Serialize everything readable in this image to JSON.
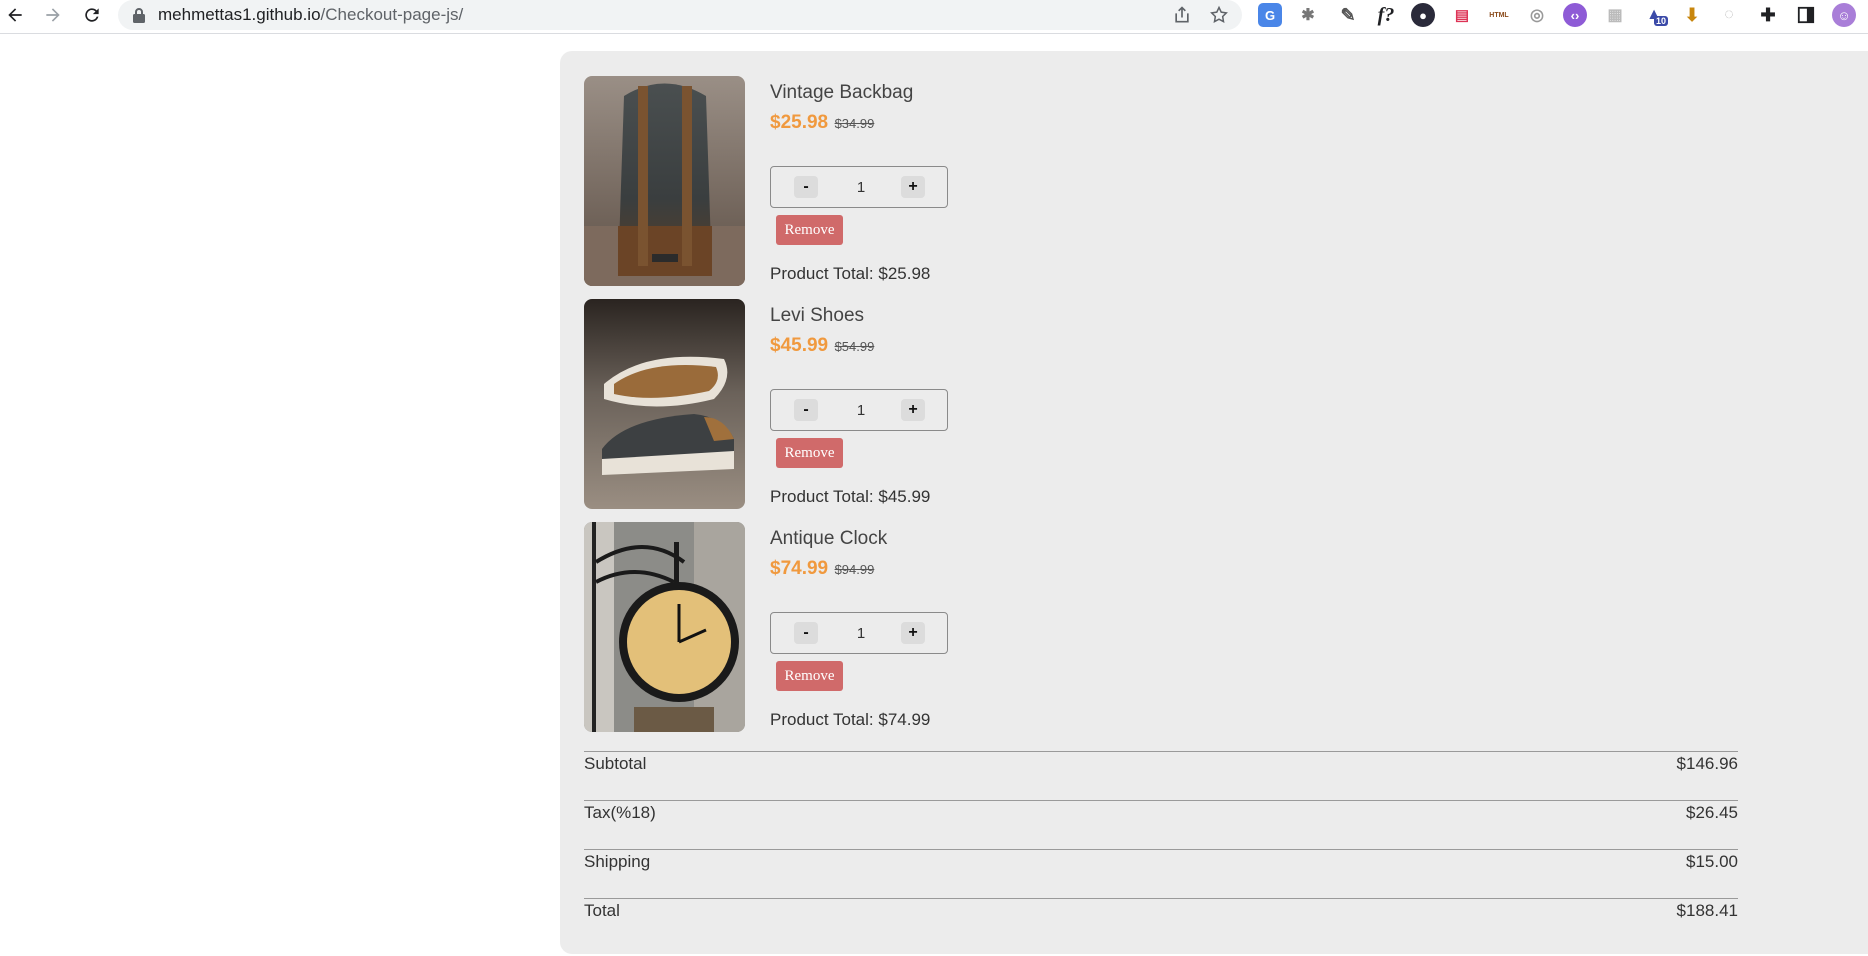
{
  "browser": {
    "url_host": "mehmettas1.github.io",
    "url_path": "/Checkout-page-js/",
    "ext_badge": "10",
    "ext_html_label": "HTML"
  },
  "products": [
    {
      "name": "Vintage Backbag",
      "price": "$25.98",
      "old_price": "$34.99",
      "quantity": "1",
      "minus_label": "-",
      "plus_label": "+",
      "remove_label": "Remove",
      "total": "Product Total: $25.98"
    },
    {
      "name": "Levi Shoes",
      "price": "$45.99",
      "old_price": "$54.99",
      "quantity": "1",
      "minus_label": "-",
      "plus_label": "+",
      "remove_label": "Remove",
      "total": "Product Total: $45.99"
    },
    {
      "name": "Antique Clock",
      "price": "$74.99",
      "old_price": "$94.99",
      "quantity": "1",
      "minus_label": "-",
      "plus_label": "+",
      "remove_label": "Remove",
      "total": "Product Total: $74.99"
    }
  ],
  "summary": [
    {
      "label": "Subtotal",
      "value": "$146.96"
    },
    {
      "label": "Tax(%18)",
      "value": "$26.45"
    },
    {
      "label": "Shipping",
      "value": "$15.00"
    },
    {
      "label": "Total",
      "value": "$188.41"
    }
  ],
  "colors": {
    "price": "#f0993e",
    "remove": "#d06a6a",
    "panel": "#ececec"
  }
}
